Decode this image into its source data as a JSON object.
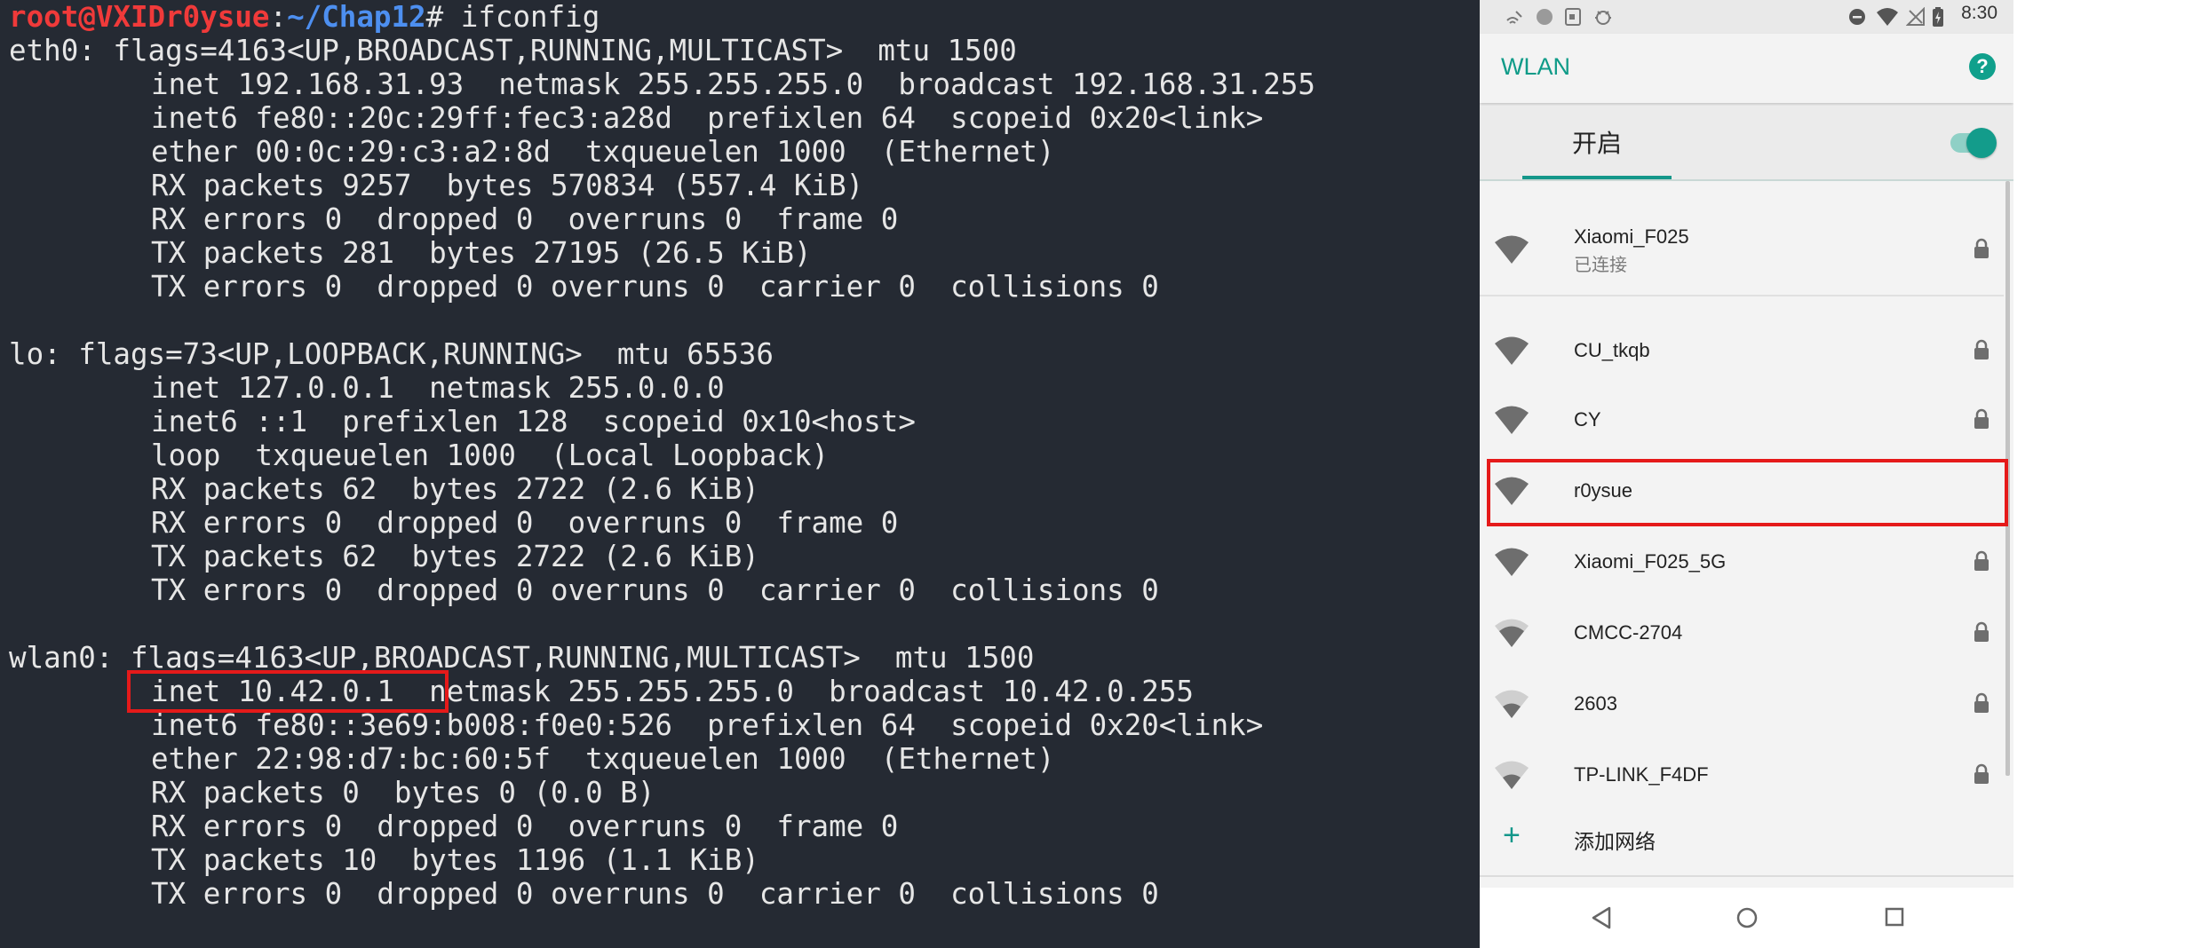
{
  "terminal": {
    "prompt": {
      "user_host": "root@VXIDr0ysue",
      "sep": ":",
      "path": "~/Chap12",
      "symbol": "# ",
      "command": "ifconfig"
    },
    "lines": [
      "eth0: flags=4163<UP,BROADCAST,RUNNING,MULTICAST>  mtu 1500",
      "inet 192.168.31.93  netmask 255.255.255.0  broadcast 192.168.31.255",
      "inet6 fe80::20c:29ff:fec3:a28d  prefixlen 64  scopeid 0x20<link>",
      "ether 00:0c:29:c3:a2:8d  txqueuelen 1000  (Ethernet)",
      "RX packets 9257  bytes 570834 (557.4 KiB)",
      "RX errors 0  dropped 0  overruns 0  frame 0",
      "TX packets 281  bytes 27195 (26.5 KiB)",
      "TX errors 0  dropped 0 overruns 0  carrier 0  collisions 0",
      "lo: flags=73<UP,LOOPBACK,RUNNING>  mtu 65536",
      "inet 127.0.0.1  netmask 255.0.0.0",
      "inet6 ::1  prefixlen 128  scopeid 0x10<host>",
      "loop  txqueuelen 1000  (Local Loopback)",
      "RX packets 62  bytes 2722 (2.6 KiB)",
      "RX errors 0  dropped 0  overruns 0  frame 0",
      "TX packets 62  bytes 2722 (2.6 KiB)",
      "TX errors 0  dropped 0 overruns 0  carrier 0  collisions 0",
      "wlan0: flags=4163<UP,BROADCAST,RUNNING,MULTICAST>  mtu 1500",
      "inet 10.42.0.1  netmask 255.255.255.0  broadcast 10.42.0.255",
      "inet6 fe80::3e69:b008:f0e0:526  prefixlen 64  scopeid 0x20<link>",
      "ether 22:98:d7:bc:60:5f  txqueuelen 1000  (Ethernet)",
      "RX packets 0  bytes 0 (0.0 B)",
      "RX errors 0  dropped 0  overruns 0  frame 0",
      "TX packets 10  bytes 1196 (1.1 KiB)",
      "TX errors 0  dropped 0 overruns 0  carrier 0  collisions 0"
    ]
  },
  "phone": {
    "status_bar": {
      "time": "8:30"
    },
    "app_bar": {
      "title": "WLAN",
      "help": "?"
    },
    "wifi_switch": {
      "label": "开启",
      "enabled": true
    },
    "networks": [
      {
        "name": "Xiaomi_F025",
        "status": "已连接",
        "secured": true,
        "signal": 4
      },
      {
        "name": "CU_tkqb",
        "secured": true,
        "signal": 4
      },
      {
        "name": "CY",
        "secured": true,
        "signal": 4
      },
      {
        "name": "r0ysue",
        "secured": false,
        "signal": 4
      },
      {
        "name": "Xiaomi_F025_5G",
        "secured": true,
        "signal": 4
      },
      {
        "name": "CMCC-2704",
        "secured": true,
        "signal": 3
      },
      {
        "name": "2603",
        "secured": true,
        "signal": 2
      },
      {
        "name": "TP-LINK_F4DF",
        "secured": true,
        "signal": 2
      }
    ],
    "add_network": {
      "icon": "+",
      "label": "添加网络"
    },
    "nav": [
      "back-icon",
      "home-icon",
      "recents-icon"
    ]
  },
  "colors": {
    "accent": "#14978a",
    "highlight": "#e51a1a",
    "terminal_bg": "#252a33",
    "prompt_user": "#f03a3a",
    "prompt_path": "#4d8ff0"
  }
}
